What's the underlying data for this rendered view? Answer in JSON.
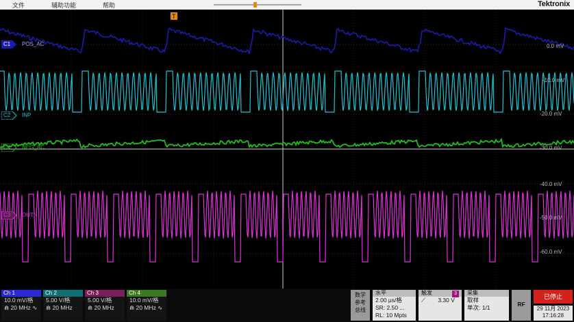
{
  "menu": {
    "file": "文件",
    "utility": "辅助功能",
    "help": "帮助"
  },
  "brand": "Tektronix",
  "trigger_marker": "T",
  "channels": [
    {
      "id": "C1",
      "label": "POS_AC",
      "color": "#1b1bb0"
    },
    {
      "id": "C2",
      "label": "INP",
      "color": "#19c6d6"
    },
    {
      "id": "C4",
      "label": "NEG_AC",
      "color": "#1fbf1f"
    },
    {
      "id": "C3",
      "label": "OUTN",
      "color": "#e52fe0"
    }
  ],
  "scale_labels": [
    "0.0 mV",
    "-10.0 mV",
    "-20.0 mV",
    "-30.0 mV",
    "-40.0 mV",
    "-50.0 mV",
    "-60.0 mV"
  ],
  "status_channels": [
    {
      "name": "Ch 1",
      "volts": "10.0 mV/格",
      "bw": "20 MHz",
      "color": "#2a2ad0"
    },
    {
      "name": "Ch 2",
      "volts": "5.00 V/格",
      "bw": "20 MHz",
      "color": "#0f6e76"
    },
    {
      "name": "Ch 3",
      "volts": "5.00 V/格",
      "bw": "20 MHz",
      "color": "#7a1f5a"
    },
    {
      "name": "Ch 4",
      "volts": "10.0 mV/格",
      "bw": "20 MHz",
      "color": "#3d7a1f"
    }
  ],
  "math_button": [
    "数学",
    "参考",
    "总线"
  ],
  "horizontal": {
    "title": "水平",
    "time": "2.00 µs/格",
    "sr": "SR: 2.50 ...",
    "rl": "RL: 10 Mpts"
  },
  "trigger": {
    "title": "触发",
    "source": "3",
    "level": "3.30 V"
  },
  "acquire": {
    "title": "采集",
    "mode": "取样",
    "count": "单次: 1/1"
  },
  "rf_button": "RF",
  "run_state": "已停止",
  "date": "29 11月 2023",
  "time": "17:16:28"
}
